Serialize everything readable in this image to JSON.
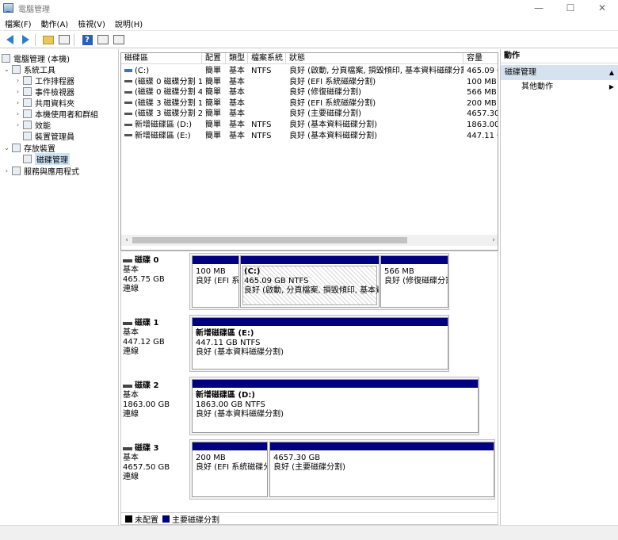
{
  "window": {
    "title": "電腦管理",
    "minimize": "—",
    "maximize": "☐",
    "close": "✕"
  },
  "menu": [
    "檔案(F)",
    "動作(A)",
    "檢視(V)",
    "說明(H)"
  ],
  "tree": {
    "root": "電腦管理 (本機)",
    "system_tools": "系統工具",
    "task_scheduler": "工作排程器",
    "event_viewer": "事件檢視器",
    "shared_folders": "共用資料夾",
    "local_users": "本機使用者和群組",
    "performance": "效能",
    "device_manager": "裝置管理員",
    "storage": "存放裝置",
    "disk_management": "磁碟管理",
    "services_apps": "服務與應用程式"
  },
  "volume_list": {
    "columns": [
      "磁碟區",
      "配置",
      "類型",
      "檔案系統",
      "狀態",
      "容量"
    ],
    "rows": [
      [
        "(C:)",
        "簡單",
        "基本",
        "NTFS",
        "良好 (啟動, 分頁檔案, 損毀傾印, 基本資料磁碟分割)",
        "465.09 G"
      ],
      [
        "(磁碟 0 磁碟分割 1)",
        "簡單",
        "基本",
        "",
        "良好 (EFI 系統磁碟分割)",
        "100 MB"
      ],
      [
        "(磁碟 0 磁碟分割 4)",
        "簡單",
        "基本",
        "",
        "良好 (修復磁碟分割)",
        "566 MB"
      ],
      [
        "(磁碟 3 磁碟分割 1)",
        "簡單",
        "基本",
        "",
        "良好 (EFI 系統磁碟分割)",
        "200 MB"
      ],
      [
        "(磁碟 3 磁碟分割 2)",
        "簡單",
        "基本",
        "",
        "良好 (主要磁碟分割)",
        "4657.30"
      ],
      [
        "新增磁碟區 (D:)",
        "簡單",
        "基本",
        "NTFS",
        "良好 (基本資料磁碟分割)",
        "1863.00"
      ],
      [
        "新增磁碟區 (E:)",
        "簡單",
        "基本",
        "NTFS",
        "良好 (基本資料磁碟分割)",
        "447.11 G"
      ]
    ]
  },
  "disks": [
    {
      "name": "磁碟 0",
      "type": "基本",
      "size": "465.75 GB",
      "status": "連線",
      "partitions": [
        {
          "title": "",
          "line1": "100 MB",
          "line2": "良好 (EFI 系"
        },
        {
          "title": "(C:)",
          "line1": "465.09 GB NTFS",
          "line2": "良好 (啟動, 分頁檔案, 損毀傾印, 基本資"
        },
        {
          "title": "",
          "line1": "566 MB",
          "line2": "良好 (修復磁碟分割"
        }
      ]
    },
    {
      "name": "磁碟 1",
      "type": "基本",
      "size": "447.12 GB",
      "status": "連線",
      "partitions": [
        {
          "title": "新增磁碟區 (E:)",
          "line1": "447.11 GB NTFS",
          "line2": "良好 (基本資料磁碟分割)"
        }
      ]
    },
    {
      "name": "磁碟 2",
      "type": "基本",
      "size": "1863.00 GB",
      "status": "連線",
      "partitions": [
        {
          "title": "新增磁碟區 (D:)",
          "line1": "1863.00 GB NTFS",
          "line2": "良好 (基本資料磁碟分割)"
        }
      ]
    },
    {
      "name": "磁碟 3",
      "type": "基本",
      "size": "4657.50 GB",
      "status": "連線",
      "partitions": [
        {
          "title": "",
          "line1": "200 MB",
          "line2": "良好 (EFI 系統磁碟分"
        },
        {
          "title": "",
          "line1": "4657.30 GB",
          "line2": "良好 (主要磁碟分割)"
        }
      ]
    }
  ],
  "legend": {
    "unallocated": "未配置",
    "primary": "主要磁碟分割",
    "unallocated_color": "#000000",
    "primary_color": "#000080"
  },
  "actions": {
    "header": "動作",
    "section": "磁碟管理",
    "more": "其他動作"
  }
}
